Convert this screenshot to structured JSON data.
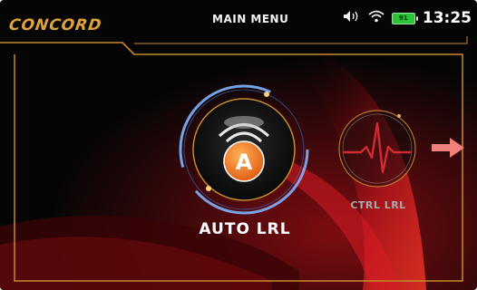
{
  "header": {
    "brand": "CONCORD",
    "title": "MAIN MENU",
    "status": {
      "speaker_icon": "speaker-sound-icon",
      "wifi_icon": "wifi-icon",
      "battery_level": "91",
      "time": "13:25"
    }
  },
  "menu": {
    "items": [
      {
        "label": "AUTO LRL",
        "icon": "auto-a-icon",
        "selected": true
      },
      {
        "label": "CTRL LRL",
        "icon": "heartbeat-icon",
        "selected": false
      }
    ],
    "next_icon": "arrow-right-icon"
  },
  "colors": {
    "brand": "#e0a23a",
    "frame": "#c88a2e",
    "accent_orange": "#f07a22",
    "ring_blue": "#7fb4ff",
    "heartbeat_red": "#e0303a",
    "arrow": "#f0807a"
  }
}
